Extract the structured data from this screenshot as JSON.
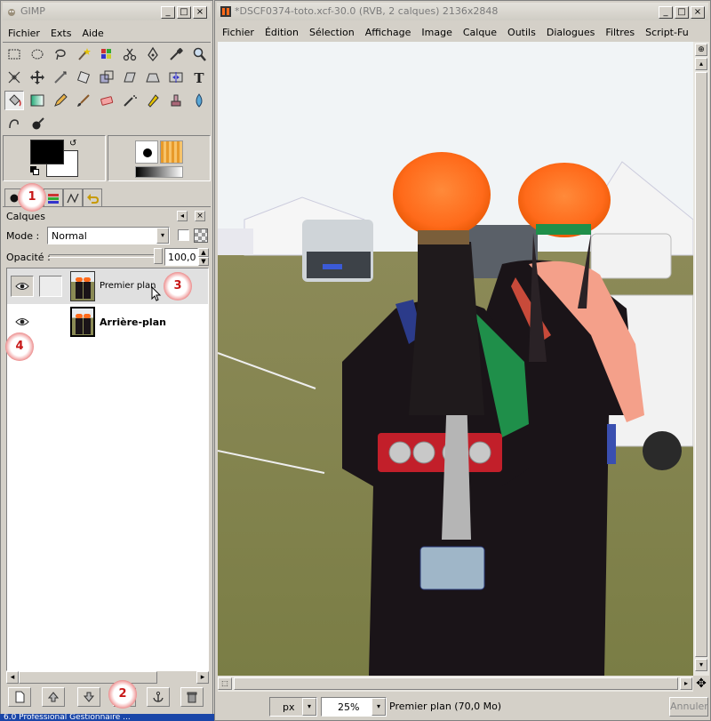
{
  "toolbox": {
    "title": "GIMP",
    "menu": [
      "Fichier",
      "Exts",
      "Aide"
    ]
  },
  "layers": {
    "title": "Calques",
    "mode_label": "Mode :",
    "mode_value": "Normal",
    "opacity_label": "Opacité :",
    "opacity_value": "100,0",
    "opacity_fraction": 1.0,
    "rows": [
      {
        "name": "Premier plan",
        "visible": true,
        "selected": true
      },
      {
        "name": "Arrière-plan",
        "visible": true,
        "selected": false
      }
    ]
  },
  "annotations": [
    "1",
    "2",
    "3",
    "4"
  ],
  "image_window": {
    "title": "*DSCF0374-toto.xcf-30.0 (RVB, 2 calques) 2136x2848",
    "menu": [
      "Fichier",
      "Édition",
      "Sélection",
      "Affichage",
      "Image",
      "Calque",
      "Outils",
      "Dialogues",
      "Filtres",
      "Script-Fu"
    ],
    "unit": "px",
    "zoom": "25%",
    "status": "Premier plan (70,0 Mo)",
    "cancel_label": "Annuler"
  },
  "taskbar": {
    "text": "6.0 Professional   Gestionnaire ..."
  },
  "colors": {
    "fur_hat": "#ff6a1a",
    "robe": "#1a1418",
    "green_sleeve": "#1f8f4a",
    "pink_sleeve": "#f4a08a",
    "grass": "#8a8a55",
    "badge_red": "#c71818"
  }
}
